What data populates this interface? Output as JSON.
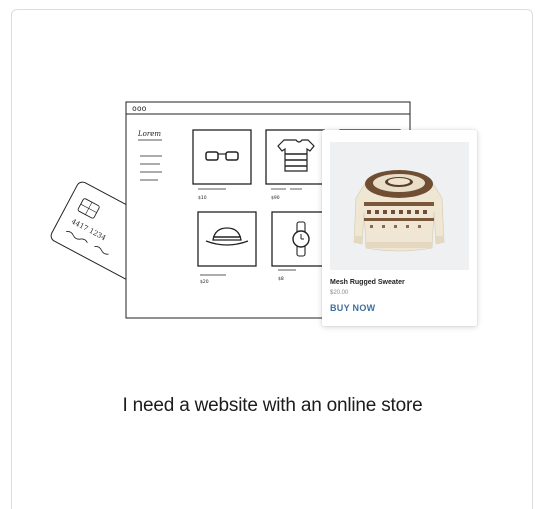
{
  "browser": {
    "window_dots": "ooo"
  },
  "store_sketch": {
    "logo_text": "Lorem",
    "prices": [
      "$10",
      "$90",
      "$20",
      "$8"
    ],
    "credit_card_number": "4417 1234"
  },
  "product": {
    "name": "Mesh Rugged Sweater",
    "price": "$20.00",
    "buy_label": "BUY NOW"
  },
  "option": {
    "title": "I need a website with an online store"
  },
  "colors": {
    "accent": "#3f6f9f",
    "card_border": "#dcdcdc",
    "image_bg": "#eef0f2"
  }
}
